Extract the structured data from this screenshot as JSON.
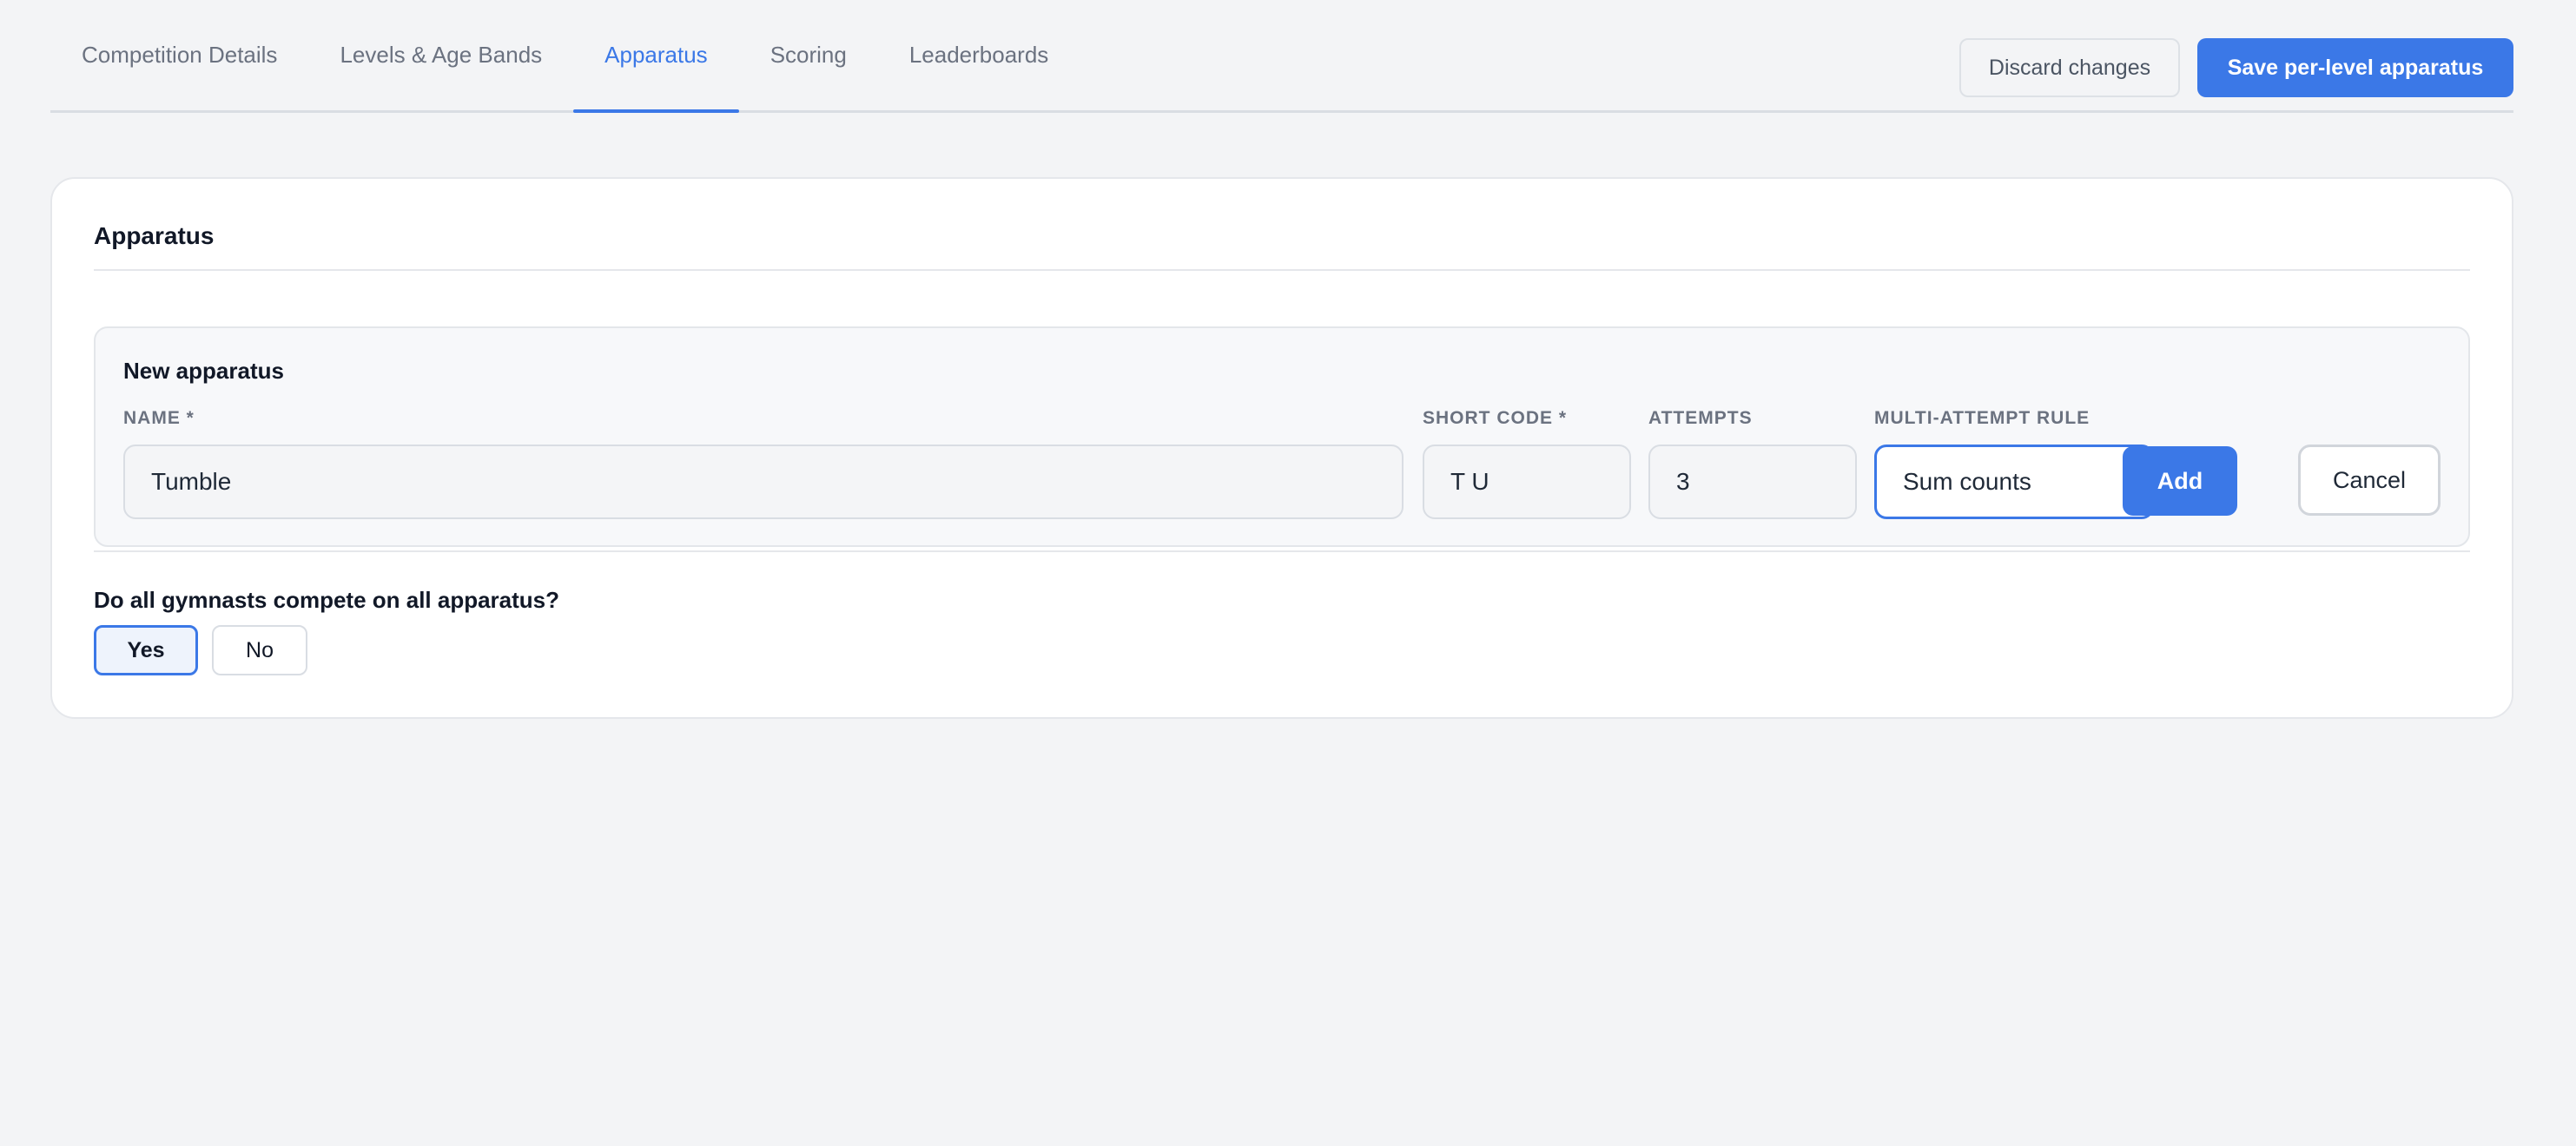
{
  "tabs": [
    {
      "label": "Competition Details",
      "active": false
    },
    {
      "label": "Levels & Age Bands",
      "active": false
    },
    {
      "label": "Apparatus",
      "active": true
    },
    {
      "label": "Scoring",
      "active": false
    },
    {
      "label": "Leaderboards",
      "active": false
    }
  ],
  "actions": {
    "discard_label": "Discard changes",
    "save_label": "Save per-level apparatus"
  },
  "card": {
    "title": "Apparatus"
  },
  "new_apparatus": {
    "title": "New apparatus",
    "name": {
      "label": "NAME *",
      "value": "Tumble"
    },
    "short_code": {
      "label": "SHORT CODE *",
      "value": "T U"
    },
    "attempts": {
      "label": "ATTEMPTS",
      "value": "3"
    },
    "multi_attempt_rule": {
      "label": "MULTI-ATTEMPT RULE",
      "value": "Sum counts"
    },
    "add_label": "Add",
    "cancel_label": "Cancel"
  },
  "all_apparatus": {
    "question": "Do all gymnasts compete on all apparatus?",
    "yes_label": "Yes",
    "no_label": "No",
    "selected": "Yes"
  },
  "colors": {
    "accent": "#3b78e7",
    "background": "#f3f4f6",
    "card": "#ffffff"
  }
}
